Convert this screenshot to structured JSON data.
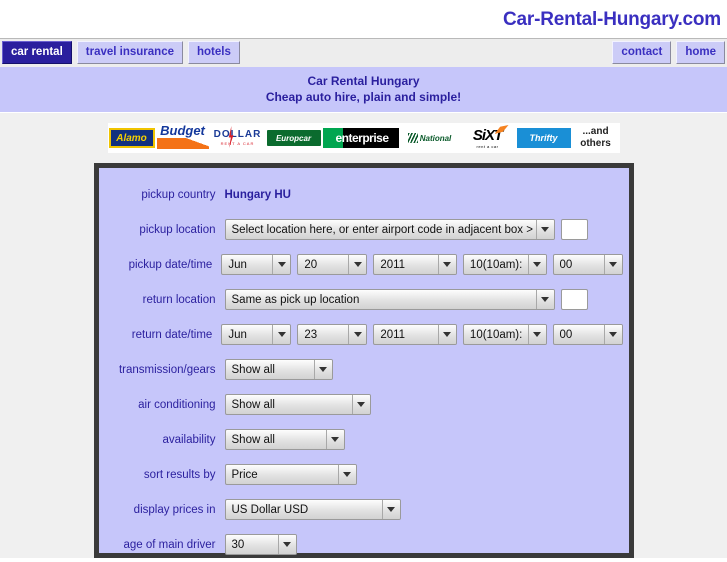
{
  "site": {
    "title": "Car-Rental-Hungary.com"
  },
  "nav": {
    "left_items": [
      {
        "label": "car rental",
        "active": true
      },
      {
        "label": "travel insurance",
        "active": false
      },
      {
        "label": "hotels",
        "active": false
      }
    ],
    "right_items": [
      {
        "label": "contact"
      },
      {
        "label": "home"
      }
    ]
  },
  "banner": {
    "line1": "Car Rental Hungary",
    "line2": "Cheap auto hire, plain and simple!"
  },
  "logos": [
    {
      "name": "alamo-logo",
      "text": "Alamo"
    },
    {
      "name": "budget-logo",
      "text": "Budget"
    },
    {
      "name": "dollar-logo",
      "text": "DOLLAR",
      "sub": "RENT A CAR"
    },
    {
      "name": "europcar-logo",
      "text": "Europcar"
    },
    {
      "name": "enterprise-logo",
      "text": "enterprise"
    },
    {
      "name": "national-logo",
      "text": "National"
    },
    {
      "name": "sixt-logo",
      "text": "SiXT",
      "sub": "rent a car"
    },
    {
      "name": "thrifty-logo",
      "text": "Thrifty"
    },
    {
      "name": "and-others-label",
      "line1": "...and",
      "line2": "others"
    }
  ],
  "form": {
    "pickup_country": {
      "label": "pickup country",
      "value": "Hungary HU"
    },
    "pickup_location": {
      "label": "pickup location",
      "value": "Select location here, or enter airport code in adjacent box >",
      "code_value": ""
    },
    "pickup_datetime": {
      "label": "pickup date/time",
      "month": "Jun",
      "day": "20",
      "year": "2011",
      "hour": "10(10am):",
      "minute": "00"
    },
    "return_location": {
      "label": "return location",
      "value": "Same as pick up location",
      "code_value": ""
    },
    "return_datetime": {
      "label": "return date/time",
      "month": "Jun",
      "day": "23",
      "year": "2011",
      "hour": "10(10am):",
      "minute": "00"
    },
    "transmission": {
      "label": "transmission/gears",
      "value": "Show all"
    },
    "air_conditioning": {
      "label": "air conditioning",
      "value": "Show all"
    },
    "availability": {
      "label": "availability",
      "value": "Show all"
    },
    "sort_results": {
      "label": "sort results by",
      "value": "Price"
    },
    "display_prices": {
      "label": "display prices in",
      "value": "US Dollar USD"
    },
    "driver_age": {
      "label": "age of main driver",
      "value": "30"
    }
  },
  "colors": {
    "brand_purple": "#2a1f9e",
    "banner_bg": "#c6c6fa",
    "nav_bg": "#ededed",
    "panel_border": "#3a3a3a",
    "active_tab_bg": "#2a1f9e"
  }
}
